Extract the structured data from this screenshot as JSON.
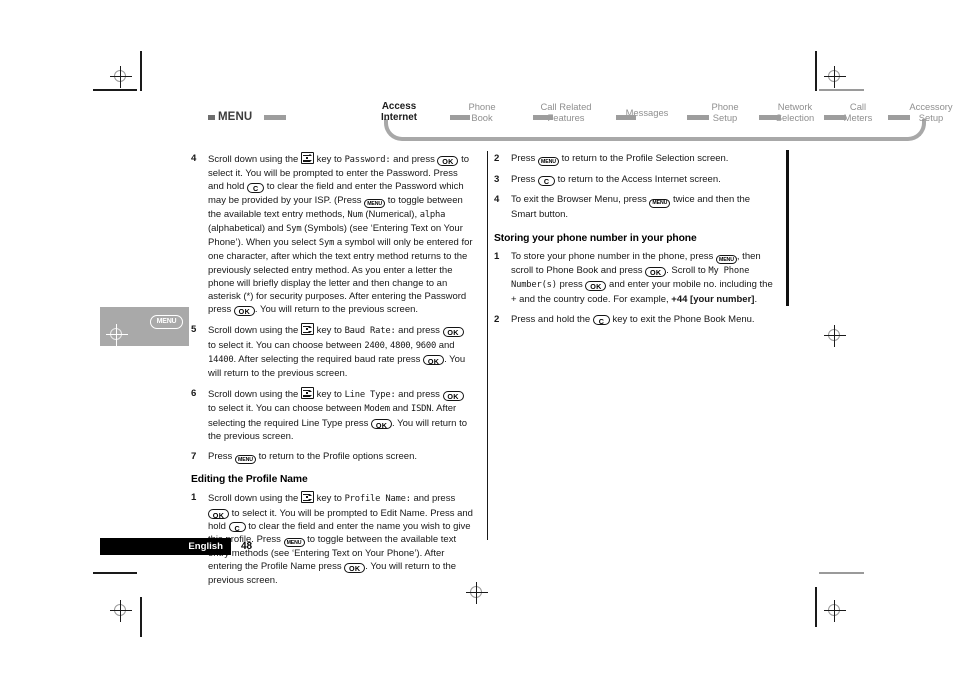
{
  "nav": {
    "menu_label": "MENU",
    "items": [
      {
        "line1": "Access",
        "line2": "Internet",
        "active": true
      },
      {
        "line1": "Phone",
        "line2": "Book",
        "active": false
      },
      {
        "line1": "Call Related",
        "line2": "Features",
        "active": false
      },
      {
        "line1": "Messages",
        "line2": "",
        "active": false
      },
      {
        "line1": "Phone",
        "line2": "Setup",
        "active": false
      },
      {
        "line1": "Network",
        "line2": "Selection",
        "active": false
      },
      {
        "line1": "Call",
        "line2": "Meters",
        "active": false
      },
      {
        "line1": "Accessory",
        "line2": "Setup",
        "active": false
      }
    ]
  },
  "keys": {
    "ok": "OK",
    "clear": "C",
    "menu": "MENU"
  },
  "callout": {
    "menu_button_label": "MENU"
  },
  "left_column": {
    "steps": [
      {
        "num": "4",
        "parts": [
          {
            "t": "text",
            "v": "Scroll down using the "
          },
          {
            "t": "navkey",
            "v": "nav-key"
          },
          {
            "t": "text",
            "v": " key to "
          },
          {
            "t": "screen",
            "v": "Password:"
          },
          {
            "t": "text",
            "v": " and press "
          },
          {
            "t": "okkey",
            "v": "OK"
          },
          {
            "t": "text",
            "v": " to select it. You will be prompted to enter the Password. Press and hold "
          },
          {
            "t": "ckey",
            "v": "C"
          },
          {
            "t": "text",
            "v": " to clear the field and enter the Password which may be provided by your ISP. (Press "
          },
          {
            "t": "menukey",
            "v": "MENU"
          },
          {
            "t": "text",
            "v": " to toggle between the available text entry methods, "
          },
          {
            "t": "screen",
            "v": "Num"
          },
          {
            "t": "text",
            "v": " (Numerical), "
          },
          {
            "t": "screen",
            "v": "alpha"
          },
          {
            "t": "text",
            "v": " (alphabetical) and "
          },
          {
            "t": "screen",
            "v": "Sym"
          },
          {
            "t": "text",
            "v": " (Symbols) (see ‘Entering Text on Your Phone’). When you select "
          },
          {
            "t": "screen",
            "v": "Sym"
          },
          {
            "t": "text",
            "v": " a symbol will only be entered for one character, after which the text entry method returns to the previously selected entry method. As you enter a letter the phone will briefly display the letter and then change to an asterisk (*) for security purposes. After entering the Password press "
          },
          {
            "t": "okkey",
            "v": "OK"
          },
          {
            "t": "text",
            "v": ". You will return to the previous screen."
          }
        ]
      },
      {
        "num": "5",
        "parts": [
          {
            "t": "text",
            "v": "Scroll down using the "
          },
          {
            "t": "navkey",
            "v": "nav-key"
          },
          {
            "t": "text",
            "v": " key to "
          },
          {
            "t": "screen",
            "v": "Baud Rate:"
          },
          {
            "t": "text",
            "v": " and press "
          },
          {
            "t": "okkey",
            "v": "OK"
          },
          {
            "t": "text",
            "v": " to select it. You can choose between "
          },
          {
            "t": "screen",
            "v": "2400"
          },
          {
            "t": "text",
            "v": ", "
          },
          {
            "t": "screen",
            "v": "4800"
          },
          {
            "t": "text",
            "v": ", "
          },
          {
            "t": "screen",
            "v": "9600"
          },
          {
            "t": "text",
            "v": " and "
          },
          {
            "t": "screen",
            "v": "14400"
          },
          {
            "t": "text",
            "v": ". After selecting the required baud rate press "
          },
          {
            "t": "okkey",
            "v": "OK"
          },
          {
            "t": "text",
            "v": ". You will return to the previous screen."
          }
        ]
      },
      {
        "num": "6",
        "parts": [
          {
            "t": "text",
            "v": "Scroll down using the "
          },
          {
            "t": "navkey",
            "v": "nav-key"
          },
          {
            "t": "text",
            "v": " key to "
          },
          {
            "t": "screen",
            "v": "Line Type:"
          },
          {
            "t": "text",
            "v": " and press "
          },
          {
            "t": "okkey",
            "v": "OK"
          },
          {
            "t": "text",
            "v": " to select it. You can choose between "
          },
          {
            "t": "screen",
            "v": "Modem"
          },
          {
            "t": "text",
            "v": " and "
          },
          {
            "t": "screen",
            "v": "ISDN"
          },
          {
            "t": "text",
            "v": ". After selecting the required Line Type press "
          },
          {
            "t": "okkey",
            "v": "OK"
          },
          {
            "t": "text",
            "v": ". You will return to the previous screen."
          }
        ]
      },
      {
        "num": "7",
        "parts": [
          {
            "t": "text",
            "v": "Press "
          },
          {
            "t": "menukey",
            "v": "MENU"
          },
          {
            "t": "text",
            "v": " to return to the Profile options screen."
          }
        ]
      }
    ],
    "subhead": "Editing the Profile Name",
    "steps2": [
      {
        "num": "1",
        "parts": [
          {
            "t": "text",
            "v": "Scroll down using the "
          },
          {
            "t": "navkey",
            "v": "nav-key"
          },
          {
            "t": "text",
            "v": " key to "
          },
          {
            "t": "screen",
            "v": "Profile Name:"
          },
          {
            "t": "text",
            "v": " and press "
          },
          {
            "t": "okkey",
            "v": "OK"
          },
          {
            "t": "text",
            "v": " to select it. You will be prompted to Edit Name. Press and hold "
          },
          {
            "t": "ckey",
            "v": "C"
          },
          {
            "t": "text",
            "v": " to clear the field and enter the name you wish to give this profile. Press "
          },
          {
            "t": "menukey",
            "v": "MENU"
          },
          {
            "t": "text",
            "v": " to toggle between the available text entry methods (see ‘Entering Text on Your Phone’). After entering the Profile Name press "
          },
          {
            "t": "okkey",
            "v": "OK"
          },
          {
            "t": "text",
            "v": ". You will return to the previous screen."
          }
        ]
      }
    ]
  },
  "right_column": {
    "steps": [
      {
        "num": "2",
        "parts": [
          {
            "t": "text",
            "v": "Press "
          },
          {
            "t": "menukey",
            "v": "MENU"
          },
          {
            "t": "text",
            "v": " to return to the Profile Selection screen."
          }
        ]
      },
      {
        "num": "3",
        "parts": [
          {
            "t": "text",
            "v": "Press "
          },
          {
            "t": "ckey",
            "v": "C"
          },
          {
            "t": "text",
            "v": " to return to the Access Internet screen."
          }
        ]
      },
      {
        "num": "4",
        "parts": [
          {
            "t": "text",
            "v": "To exit the Browser Menu, press "
          },
          {
            "t": "menukey",
            "v": "MENU"
          },
          {
            "t": "text",
            "v": " twice and then the Smart button."
          }
        ]
      }
    ],
    "subhead": "Storing your phone number in your phone",
    "steps2": [
      {
        "num": "1",
        "parts": [
          {
            "t": "text",
            "v": "To store your phone number in the phone, press "
          },
          {
            "t": "menukey",
            "v": "MENU"
          },
          {
            "t": "text",
            "v": ", then scroll to Phone Book and press "
          },
          {
            "t": "okkey",
            "v": "OK"
          },
          {
            "t": "text",
            "v": ". Scroll to "
          },
          {
            "t": "screen",
            "v": "My Phone Number(s)"
          },
          {
            "t": "text",
            "v": " press "
          },
          {
            "t": "okkey",
            "v": "OK"
          },
          {
            "t": "text",
            "v": " and enter your mobile no. including the + and the country code. For example, "
          },
          {
            "t": "strong",
            "v": "+44 [your number]"
          },
          {
            "t": "text",
            "v": "."
          }
        ]
      },
      {
        "num": "2",
        "parts": [
          {
            "t": "text",
            "v": "Press and hold the "
          },
          {
            "t": "ckey",
            "v": "C"
          },
          {
            "t": "text",
            "v": " key to exit the Phone Book Menu."
          }
        ]
      }
    ]
  },
  "footer": {
    "language": "English",
    "page_number": "48"
  }
}
